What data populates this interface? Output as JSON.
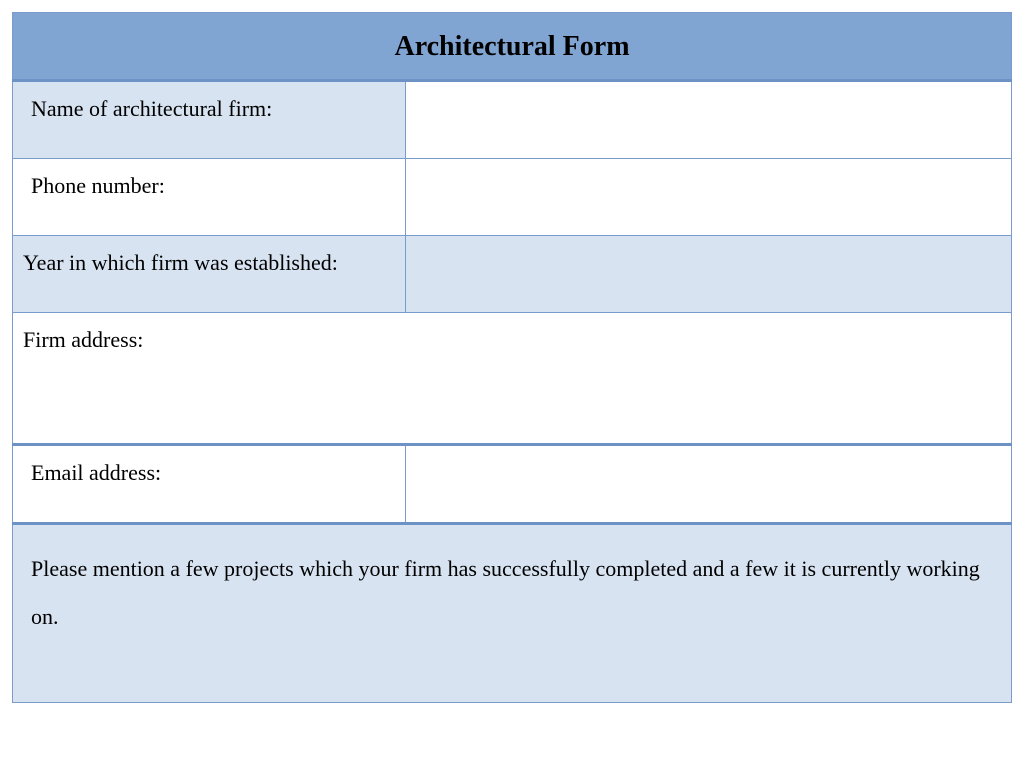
{
  "form": {
    "title": "Architectural Form",
    "rows": {
      "firm_name": {
        "label": "Name of architectural firm:"
      },
      "phone": {
        "label": "Phone number:"
      },
      "year_established": {
        "label": "Year in which firm was established:"
      },
      "address": {
        "label": "Firm address:"
      },
      "email": {
        "label": "Email address:"
      },
      "projects": {
        "prompt": "Please mention a few projects which your firm has successfully completed and a few it is currently working on."
      }
    }
  }
}
